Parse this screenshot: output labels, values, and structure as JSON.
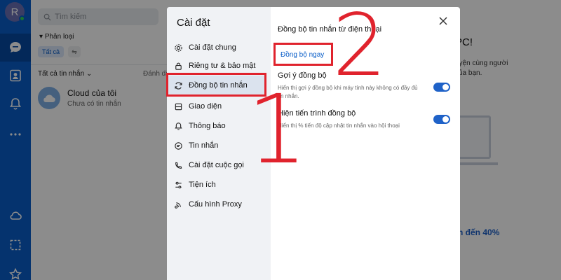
{
  "rail": {
    "avatar_letter": "R",
    "icons": [
      "chat-icon",
      "contacts-icon",
      "bell-icon",
      "more-icon",
      "cloud-icon",
      "screenshot-icon",
      "star-icon"
    ]
  },
  "list": {
    "search_placeholder": "Tìm kiếm",
    "category_label": "Phân loại",
    "chip_all": "Tất cả",
    "filter_label": "Tất cả tin nhắn",
    "mark_label": "Đánh dấu",
    "cloud": {
      "name": "Cloud của tôi",
      "subtitle": "Chưa có tin nhắn"
    }
  },
  "background_main": {
    "title": "PC!",
    "desc": "uyện cùng người\ncủa bạn.",
    "promo": "iên đến 40%"
  },
  "settings": {
    "title": "Cài đặt",
    "menu": [
      {
        "label": "Cài đặt chung",
        "icon": "gear-icon"
      },
      {
        "label": "Riêng tư & bảo mật",
        "icon": "lock-icon"
      },
      {
        "label": "Đồng bộ tin nhắn",
        "icon": "sync-icon",
        "active": true
      },
      {
        "label": "Giao diện",
        "icon": "palette-icon"
      },
      {
        "label": "Thông báo",
        "icon": "bell-icon"
      },
      {
        "label": "Tin nhắn",
        "icon": "message-icon"
      },
      {
        "label": "Cài đặt cuộc gọi",
        "icon": "phone-icon"
      },
      {
        "label": "Tiện ích",
        "icon": "tools-icon"
      },
      {
        "label": "Cấu hình Proxy",
        "icon": "proxy-icon"
      }
    ],
    "section_title": "Đồng bộ tin nhắn từ điện thoại",
    "sync_now": "Đồng bộ ngay",
    "options": [
      {
        "label": "Gợi ý đồng bộ",
        "desc": "Hiển thị gợi ý đồng bộ khi máy tính này không có đầy đủ tin nhắn.",
        "on": true
      },
      {
        "label": "Hiện tiến trình đồng bộ",
        "desc": "Hiển thị % tiến độ cập nhật tin nhắn vào hội thoại",
        "on": true
      }
    ]
  },
  "annotations": {
    "step1": "1",
    "step2": "2"
  },
  "colors": {
    "rail": "#0a5ec8",
    "highlight": "#e0232d",
    "toggle": "#1f62c8"
  }
}
